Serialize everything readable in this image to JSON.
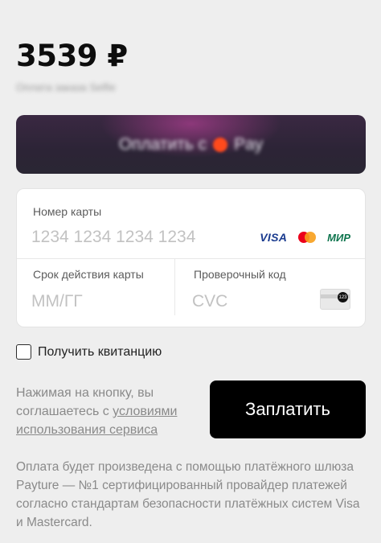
{
  "amount": "3539 ₽",
  "subtitle": "Оплата заказа Selfie",
  "wallet_button": {
    "label": "Оплатить с",
    "brand": "Pay"
  },
  "card_form": {
    "card_number": {
      "label": "Номер карты",
      "placeholder": "1234 1234 1234 1234"
    },
    "brands": {
      "visa": "VISA",
      "mir": "МИР"
    },
    "expiry": {
      "label": "Срок действия карты",
      "placeholder": "ММ/ГГ"
    },
    "cvc": {
      "label": "Проверочный код",
      "placeholder": "CVC",
      "card_badge": "123"
    }
  },
  "receipt_checkbox": {
    "label": "Получить квитанцию",
    "checked": false
  },
  "agreement": {
    "prefix": "Нажимая на кнопку, вы соглашаетесь с ",
    "link": "условиями использования сервиса"
  },
  "pay_button": {
    "label": "Заплатить"
  },
  "footer": "Оплата будет произведена с помощью платёжного шлюза Payture — №1 сертифицированный провайдер платежей согласно стандартам безопасности платёжных систем Visa и Mastercard.",
  "colors": {
    "background": "#eeeeee",
    "primary_button": "#000000",
    "mc_red": "#eb001b",
    "mc_orange": "#f79e1b",
    "visa_blue": "#1a3b8f",
    "mir_green": "#0f754e"
  }
}
